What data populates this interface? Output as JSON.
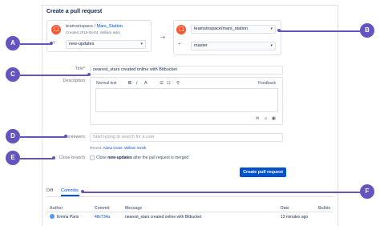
{
  "page": {
    "title": "Create a pull request"
  },
  "source": {
    "workspace": "teamsinspace",
    "separator": " / ",
    "repo": "Mars_Station",
    "meta": "Created 2015-06-04, William asks",
    "branch": "new-updates"
  },
  "destination": {
    "repo": "teamsinspace/mars_station",
    "branch": "master"
  },
  "form": {
    "title_label": "Title",
    "title_required": "*",
    "title_value": "nearest_stars created online with Bitbucket",
    "description_label": "Description",
    "editor": {
      "mode": "Normal text",
      "bold": "B",
      "italic": "I",
      "text_color": "A",
      "bullet_list": "☰",
      "numbered_list": "☷",
      "link": "⚲",
      "feedback": "Feedback",
      "mention": "✉",
      "emoji": "☺",
      "image": "▣"
    },
    "reviewers_label": "Reviewers",
    "reviewers_placeholder": "Start typing to search for a user",
    "recent_prefix": "Recent:",
    "recent_people": [
      "Alana Grant",
      "William Smith"
    ],
    "close_branch_label": "Close branch",
    "close_branch_prefix": "Close ",
    "close_branch_strong": "new-updates",
    "close_branch_suffix": " after the pull request is merged",
    "submit": "Create pull request"
  },
  "tabs": [
    {
      "label": "Diff"
    },
    {
      "label": "Commits"
    }
  ],
  "commits": {
    "headers": [
      "Author",
      "Commit",
      "Message",
      "Date",
      "Builds"
    ],
    "rows": [
      {
        "author": "Emma Paris",
        "commit": "48c734a",
        "message": "nearest_stars created online with Bitbucket",
        "date": "13 minutes ago",
        "builds": ""
      }
    ]
  },
  "callouts": [
    "A",
    "B",
    "C",
    "D",
    "E",
    "F"
  ],
  "colors": {
    "callout": "#6554c0",
    "primary": "#0052cc",
    "repo_icon": "#ff5630"
  }
}
